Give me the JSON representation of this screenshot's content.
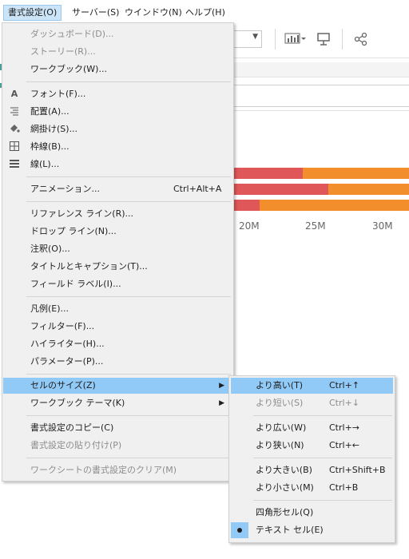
{
  "menubar": {
    "items": [
      {
        "label": "書式設定(O)",
        "active": true
      },
      {
        "label": "サーバー(S)"
      },
      {
        "label": "ウインドウ(N)"
      },
      {
        "label": "ヘルプ(H)"
      }
    ]
  },
  "chart_bg": {
    "axis_labels": [
      "20M",
      "25M",
      "30M"
    ],
    "colors": {
      "red": "#e05759",
      "orange": "#f28e2b",
      "teal": "#4e9f9a"
    }
  },
  "format_menu": {
    "items": [
      {
        "label": "ダッシュボード(D)...",
        "disabled": true
      },
      {
        "label": "ストーリー(R)...",
        "disabled": true
      },
      {
        "label": "ワークブック(W)..."
      },
      {
        "label": "フォント(F)...",
        "icon": "font-icon"
      },
      {
        "label": "配置(A)...",
        "icon": "alignment-icon"
      },
      {
        "label": "網掛け(S)...",
        "icon": "shading-icon"
      },
      {
        "label": "枠線(B)...",
        "icon": "borders-icon"
      },
      {
        "label": "線(L)...",
        "icon": "lines-icon"
      },
      {
        "label": "アニメーション...",
        "shortcut": "Ctrl+Alt+A"
      },
      {
        "label": "リファレンス ライン(R)..."
      },
      {
        "label": "ドロップ ライン(N)..."
      },
      {
        "label": "注釈(O)..."
      },
      {
        "label": "タイトルとキャプション(T)..."
      },
      {
        "label": "フィールド ラベル(I)..."
      },
      {
        "label": "凡例(E)..."
      },
      {
        "label": "フィルター(F)..."
      },
      {
        "label": "ハイライター(H)..."
      },
      {
        "label": "パラメーター(P)..."
      },
      {
        "label": "セルのサイズ(Z)",
        "submenu": true,
        "highlighted": true
      },
      {
        "label": "ワークブック テーマ(K)",
        "submenu": true
      },
      {
        "label": "書式設定のコピー(C)"
      },
      {
        "label": "書式設定の貼り付け(P)",
        "disabled": true
      },
      {
        "label": "ワークシートの書式設定のクリア(M)",
        "disabled": true
      }
    ]
  },
  "cell_size_submenu": {
    "items": [
      {
        "label": "より高い(T)",
        "shortcut": "Ctrl+↑",
        "highlighted": true
      },
      {
        "label": "より短い(S)",
        "shortcut": "Ctrl+↓",
        "disabled": true
      },
      {
        "label": "より広い(W)",
        "shortcut": "Ctrl+→"
      },
      {
        "label": "より狭い(N)",
        "shortcut": "Ctrl+←"
      },
      {
        "label": "より大きい(B)",
        "shortcut": "Ctrl+Shift+B"
      },
      {
        "label": "より小さい(M)",
        "shortcut": "Ctrl+B"
      },
      {
        "label": "四角形セル(Q)"
      },
      {
        "label": "テキスト セル(E)",
        "checked": true
      }
    ]
  }
}
